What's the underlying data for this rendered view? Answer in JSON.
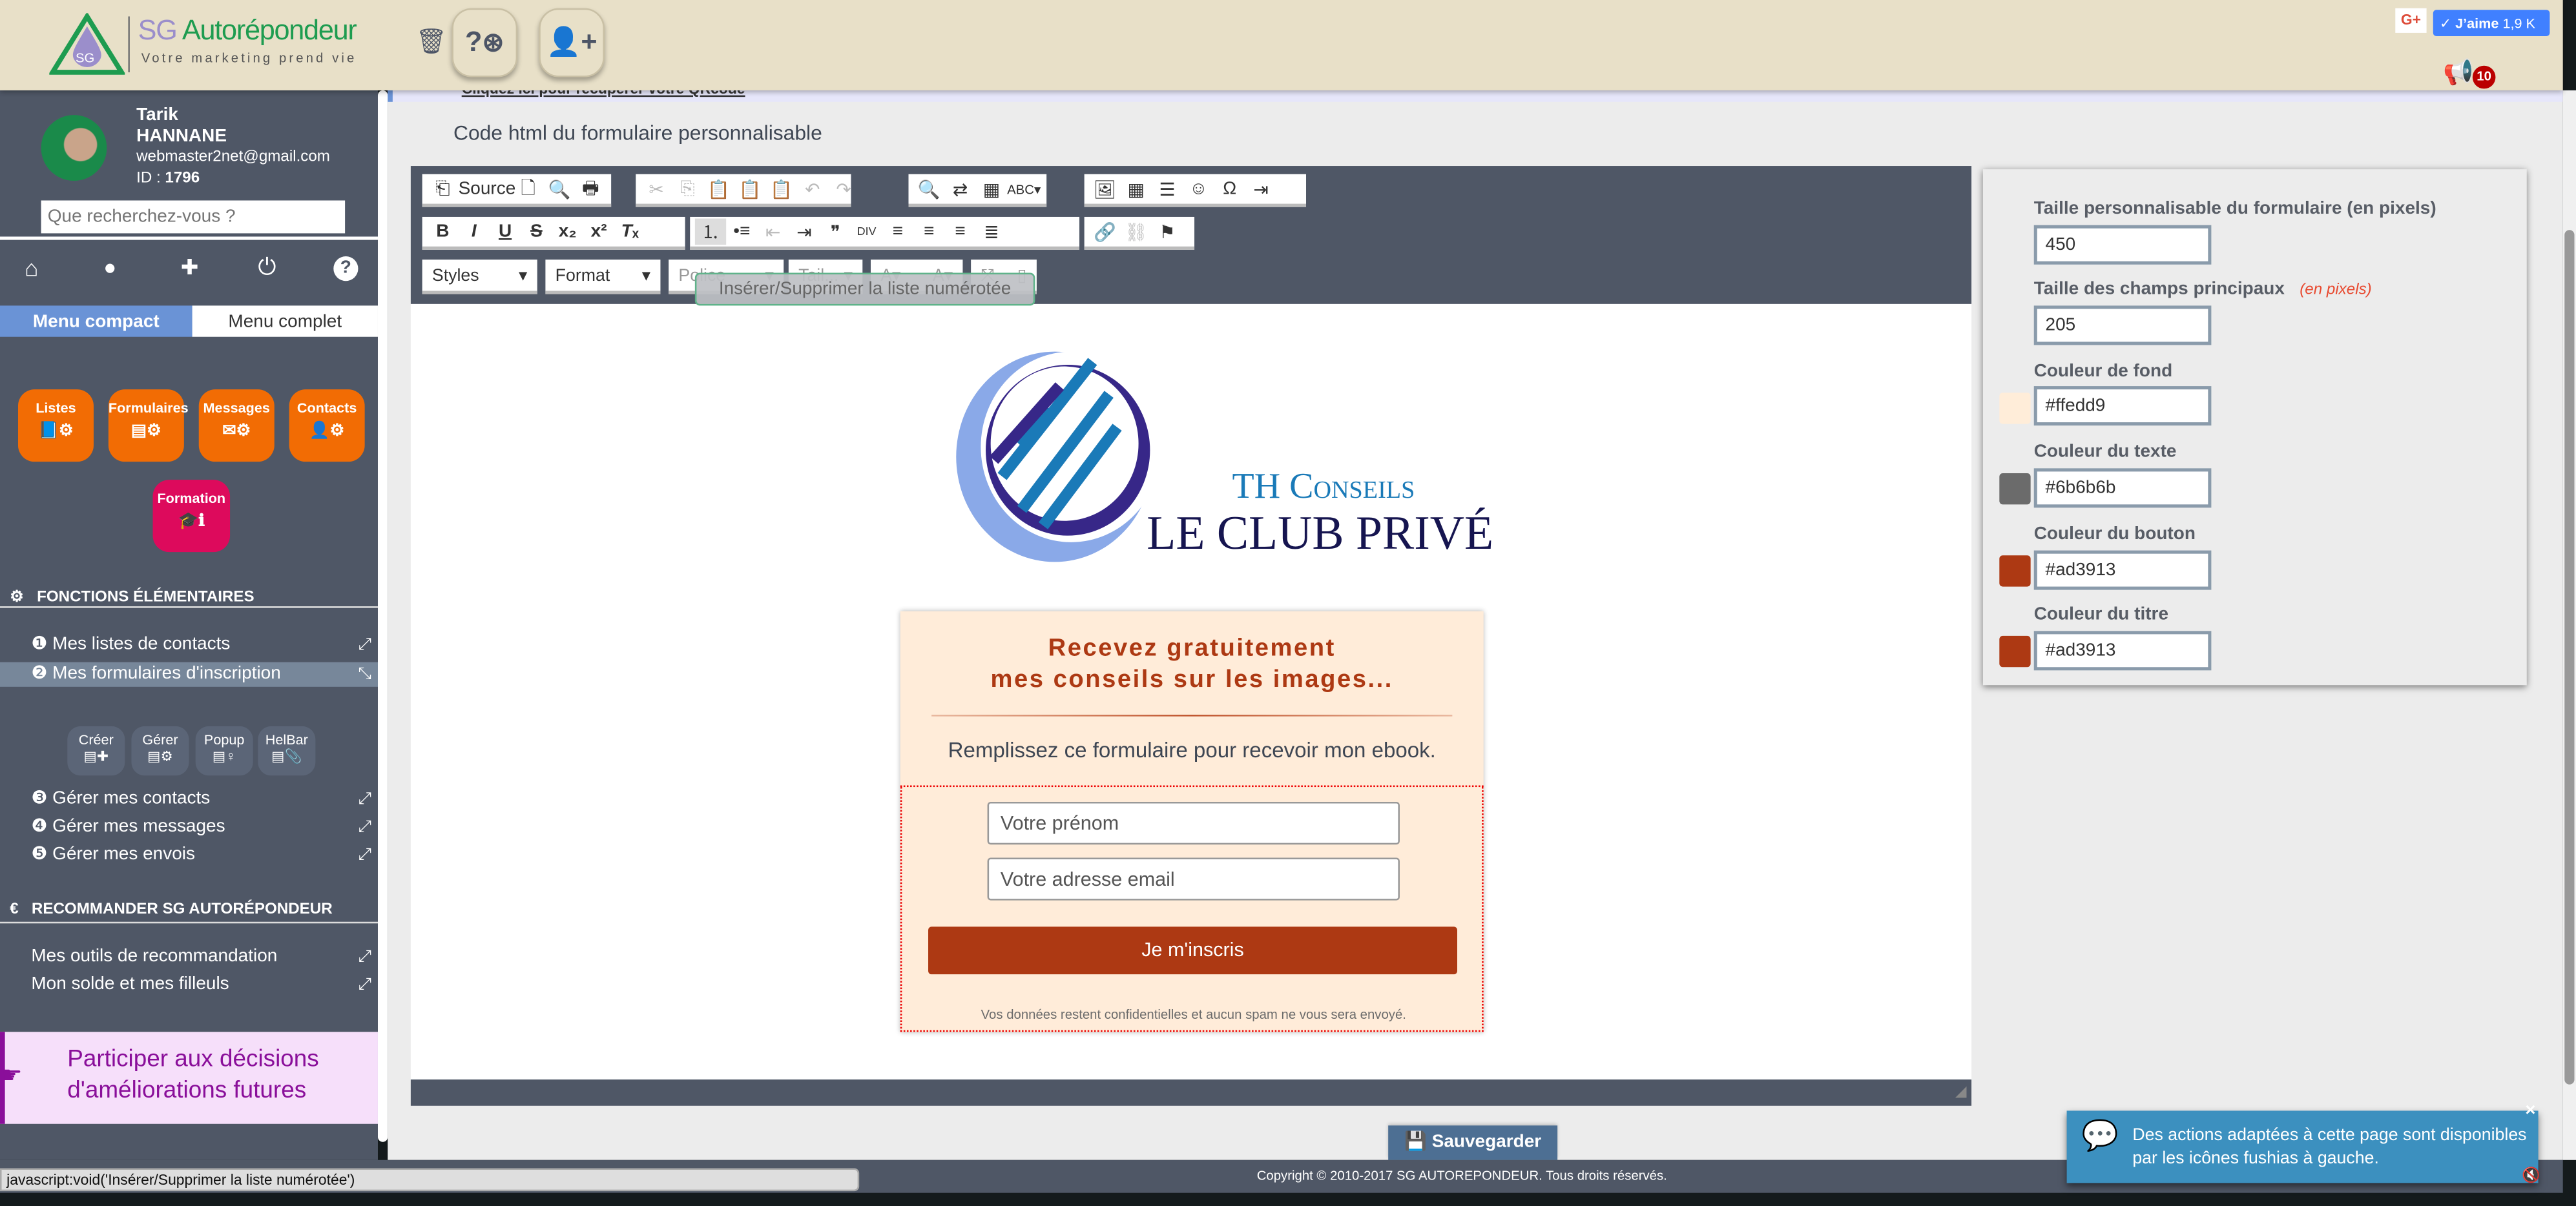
{
  "header": {
    "brand_sg": "SG",
    "brand_name": "Autorépondeur",
    "tagline": "Votre marketing prend vie",
    "logo_text": "SG",
    "icons": [
      "trash-icon",
      "help-lifebuoy-icon",
      "add-user-icon",
      "megaphone-icon"
    ],
    "help_label": "?",
    "gplus_label": "G+",
    "like_label": "J’aime",
    "like_count": "1,9 K",
    "notification_count": "10"
  },
  "sidebar": {
    "user": {
      "first_name": "Tarik",
      "last_name": "HANNANE",
      "email": "webmaster2net@gmail.com",
      "id_label": "ID :",
      "id": "1796"
    },
    "search": {
      "placeholder": "Que recherchez-vous ?",
      "value": ""
    },
    "nav_icons": [
      "home-icon",
      "user-icon",
      "puzzle-icon",
      "power-icon",
      "help-icon"
    ],
    "menu_tabs": [
      {
        "label": "Menu compact",
        "active": true
      },
      {
        "label": "Menu complet",
        "active": false
      }
    ],
    "quick_buttons": [
      {
        "label": "Listes",
        "icon": "book-gear"
      },
      {
        "label": "Formulaires",
        "icon": "form-gear"
      },
      {
        "label": "Messages",
        "icon": "envelope-gear"
      },
      {
        "label": "Contacts",
        "icon": "user-gear"
      }
    ],
    "formation": {
      "label": "Formation",
      "icon": "graduation-info"
    },
    "section1": {
      "title": "FONCTIONS ÉLÉMENTAIRES",
      "items": [
        {
          "label": "❶ Mes listes de contacts"
        },
        {
          "label": "❷ Mes formulaires d'inscription",
          "active": true
        },
        {
          "label": "❸ Gérer mes contacts"
        },
        {
          "label": "❹ Gérer mes messages"
        },
        {
          "label": "❺ Gérer mes envois"
        }
      ]
    },
    "sub_buttons": [
      {
        "label": "Créer"
      },
      {
        "label": "Gérer"
      },
      {
        "label": "Popup"
      },
      {
        "label": "HelBar"
      }
    ],
    "section2": {
      "title": "RECOMMANDER SG AUTORÉPONDEUR",
      "items": [
        {
          "label": "Mes outils de recommandation"
        },
        {
          "label": "Mon solde et mes filleuls"
        }
      ]
    },
    "promo": "Participer aux décisions d'améliorations futures"
  },
  "main": {
    "top_link": "Cliquez ici pour récupérer votre QRcode",
    "title": "Code html du formulaire personnalisable",
    "toolbar": {
      "source_label": "Source",
      "styles_label": "Styles",
      "format_label": "Format",
      "font_label": "Police",
      "size_label": "Tail...",
      "tooltip": "Insérer/Supprimer la liste numérotée"
    },
    "save_label": "Sauvegarder"
  },
  "preview": {
    "logo_line1": "TH Conseils",
    "logo_line2": "LE CLUB PRIVÉ",
    "title_line1": "Recevez gratuitement",
    "title_line2": "mes conseils sur les images...",
    "subtitle": "Remplissez ce formulaire pour recevoir mon ebook.",
    "firstname_placeholder": "Votre prénom",
    "email_placeholder": "Votre adresse email",
    "button": "Je m'inscris",
    "disclaimer": "Vos données restent confidentielles et aucun spam ne vous sera envoyé."
  },
  "panel": {
    "form_width_label": "Taille personnalisable du formulaire (en pixels)",
    "form_width": "450",
    "field_width_label": "Taille des champs principaux",
    "field_width_hint": "(en pixels)",
    "field_width": "205",
    "bg_label": "Couleur de fond",
    "bg": "#ffedd9",
    "text_label": "Couleur du texte",
    "text": "#6b6b6b",
    "button_label": "Couleur du bouton",
    "button": "#ad3913",
    "title_label": "Couleur du titre",
    "title": "#ad3913"
  },
  "footer": {
    "copyright": "Copyright © 2010-2017 SG AUTOREPONDEUR. Tous droits réservés."
  },
  "notification": {
    "text": "Des actions adaptées à cette page sont disponibles par les icônes fushias à gauche.",
    "close": "×"
  },
  "status_bar": "javascript:void('Insérer/Supprimer la liste numérotée')",
  "colors": {
    "sidebar": "#4f5766",
    "header": "#e8e0c8",
    "orange": "#f26c04",
    "fuchsia": "#dd0a5c",
    "accent_blue": "#6a93d6",
    "form_button": "#ad3913"
  }
}
